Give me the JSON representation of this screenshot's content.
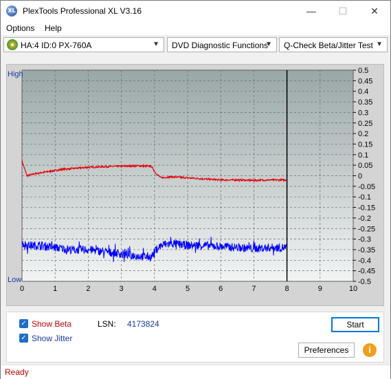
{
  "window": {
    "title": "PlexTools Professional XL V3.16",
    "icon_label": "XL",
    "minimize_glyph": "—",
    "maximize_glyph": "☐",
    "close_glyph": "✕"
  },
  "menu": {
    "items": [
      {
        "label": "Options",
        "mnemonic": "O"
      },
      {
        "label": "Help",
        "mnemonic": "H"
      }
    ]
  },
  "toolbar": {
    "drive": "HA:4 ID:0  PX-760A",
    "function": "DVD Diagnostic Functions",
    "test": "Q-Check Beta/Jitter Test",
    "dropdown_arrow": "▼"
  },
  "chart_data": {
    "type": "line",
    "left_axis_labels": {
      "top": "High",
      "bottom": "Low"
    },
    "x": {
      "min": 0,
      "max": 10,
      "ticks": [
        0,
        1,
        2,
        3,
        4,
        5,
        6,
        7,
        8,
        9,
        10
      ]
    },
    "y_right": {
      "min": -0.5,
      "max": 0.5,
      "step": 0.05,
      "ticks": [
        "0.5",
        "0.45",
        "0.4",
        "0.35",
        "0.3",
        "0.25",
        "0.2",
        "0.15",
        "0.1",
        "0.05",
        "0",
        "-0.05",
        "-0.1",
        "-0.15",
        "-0.2",
        "-0.25",
        "-0.3",
        "-0.35",
        "-0.4",
        "-0.45",
        "-0.5"
      ]
    },
    "grid": true,
    "marker_x": 8,
    "series": [
      {
        "color": "#e8000a",
        "points": [
          [
            0,
            0.07
          ],
          [
            0.15,
            0
          ],
          [
            0.4,
            0.01
          ],
          [
            0.8,
            0.02
          ],
          [
            1.2,
            0.03
          ],
          [
            1.6,
            0.035
          ],
          [
            2,
            0.04
          ],
          [
            2.5,
            0.043
          ],
          [
            3,
            0.045
          ],
          [
            3.5,
            0.047
          ],
          [
            3.9,
            0.045
          ],
          [
            4.05,
            0.01
          ],
          [
            4.2,
            -0.01
          ],
          [
            4.5,
            -0.005
          ],
          [
            5,
            -0.01
          ],
          [
            5.5,
            -0.015
          ],
          [
            6,
            -0.02
          ],
          [
            6.5,
            -0.02
          ],
          [
            7,
            -0.022
          ],
          [
            7.5,
            -0.02
          ],
          [
            8,
            -0.02
          ]
        ]
      },
      {
        "color": "#0000ff",
        "points": [
          [
            0,
            -0.32
          ],
          [
            0.2,
            -0.33
          ],
          [
            0.5,
            -0.33
          ],
          [
            1,
            -0.34
          ],
          [
            1.5,
            -0.35
          ],
          [
            2,
            -0.35
          ],
          [
            2.5,
            -0.36
          ],
          [
            3,
            -0.37
          ],
          [
            3.5,
            -0.38
          ],
          [
            3.9,
            -0.385
          ],
          [
            4.05,
            -0.35
          ],
          [
            4.2,
            -0.33
          ],
          [
            4.5,
            -0.32
          ],
          [
            5,
            -0.33
          ],
          [
            5.5,
            -0.33
          ],
          [
            6,
            -0.335
          ],
          [
            6.5,
            -0.34
          ],
          [
            7,
            -0.345
          ],
          [
            7.5,
            -0.34
          ],
          [
            8,
            -0.34
          ]
        ]
      }
    ]
  },
  "bottom": {
    "show_beta": "Show Beta",
    "show_jitter": "Show Jitter",
    "checkmark": "✓",
    "lsn_label": "LSN:",
    "lsn_value": "4173824",
    "start": "Start",
    "preferences": "Preferences",
    "info_glyph": "i"
  },
  "status": {
    "text": "Ready"
  },
  "colors": {
    "beta": "#e8000a",
    "jitter": "#0000ff",
    "status": "#cc0000",
    "plot_top": "#9aa7a7",
    "plot_bottom": "#f2f4f4"
  }
}
